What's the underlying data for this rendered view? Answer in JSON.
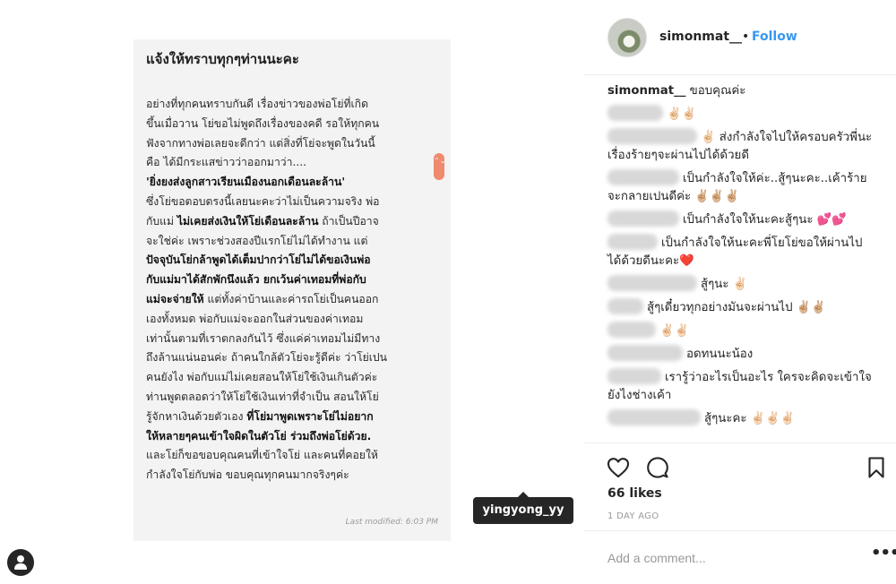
{
  "note": {
    "title": "แจ้งให้ทราบทุกๆท่านนะคะ",
    "lines": [
      "อย่างที่ทุกคนทราบกันดี เรื่องข่าวของพ่อโย่ที่เกิด",
      "ขึ้นเมื่อวาน โย่ขอไม่พูดถึงเรื่องของคดี รอให้ทุกคน",
      "ฟังจากทางพ่อเลยจะดีกว่า  แต่สิ่งที่โย่จะพูดในวันนี้",
      "คือ ได้มีกระแสข่าวว่าออกมาว่า....",
      "'ยิ่งยงส่งลูกสาวเรียนเมืองนอกเดือนละล้าน'",
      "ซึ่งโย่ขอตอบตรงนี้เลยนะคะว่าไม่เป็นความจริง พ่อ",
      "กับแม่ ",
      "ไม่เคยส่งเงินให้โย่เดือนละล้าน",
      " ถ้าเป็นปีอาจ",
      "จะใช่ค่ะ เพราะช่วงสองปีแรกโย่ไม่ได้ทำงาน แต่",
      "ปัจจุบันโย่กล้าพูดได้เต็มปากว่าโย่ไม่ได้ขอเงินพ่อ",
      "กับแม่มาได้สักพักนึงแล้ว ยกเว้นค่าเทอมที่พ่อกับ",
      "แม่จะจ่ายให้",
      " แต่ทั้งค่าบ้านและค่ารถโย่เป็นคนออก",
      "เองทั้งหมด พ่อกับแม่จะออกในส่วนของค่าเทอม",
      "เท่านั้นตามที่เราตกลงกันไว้ ซึ่งแค่ค่าเทอมไม่มีทาง",
      "ถึงล้านแน่นอนค่ะ ถ้าคนใกล้ตัวโย่จะรู้ดีค่ะ ว่าโย่เปน",
      "คนยังไง พ่อกับแม่ไม่เคยสอนให้โย่ใช้เงินเกินตัวค่ะ",
      "ท่านพูดตลอดว่าให้โย่ใช้เงินเท่าที่จำเป็น สอนให้โย่",
      "รู้จักหาเงินด้วยตัวเอง ",
      "ที่โย่มาพูดเพราะโย่ไม่อยาก",
      "ให้หลายๆคนเข้าใจผิดในตัวโย่ ร่วมถึงพ่อโย่ด้วย.",
      "และโย่ก็ขอขอบคุณคนที่เข้าใจโย่ และคนที่คอยให้",
      "กำลังใจโย่กับพ่อ ขอบคุณทุกคนมากจริงๆค่ะ"
    ],
    "scroll_glyph": "⌃⌄",
    "modified": "Last modified: 6:03 PM"
  },
  "user_tag": "yingyong_yy",
  "post": {
    "username": "simonmat__",
    "separator": "•",
    "follow_label": "Follow",
    "caption": "ขอบคุณค่ะ",
    "comments": [
      {
        "text": "✌🏻✌🏻"
      },
      {
        "text": "✌🏻 ส่งกำลังใจไปให้ครอบครัวพี่นะ เรื่องร้ายๆจะผ่านไปได้ด้วยดี"
      },
      {
        "text": "เป็นกำลังใจให้ค่ะ..สู้ๆนะคะ..เค้าร้ายจะกลายเปนดีค่ะ ✌🏼✌🏼✌🏼"
      },
      {
        "text": "เป็นกำลังใจให้นะคะสู้ๆนะ 💕💕"
      },
      {
        "text": "เป็นกำลังใจให้นะคะพี่โยโย่ขอให้ผ่านไปได้ด้วยดีนะคะ❤️"
      },
      {
        "text": "สู้ๆนะ ✌🏻"
      },
      {
        "text": "สู้ๆเดี๋ยวทุกอย่างมันจะผ่านไป ✌🏼✌🏼"
      },
      {
        "text": "✌🏻✌🏻"
      },
      {
        "text": "อดทนนะน้อง"
      },
      {
        "text": "เรารู้ว่าอะไรเป็นอะไร ใครจะคิดจะเข้าใจยังไงช่างเค้า"
      },
      {
        "text": "สู้ๆนะคะ ✌🏻✌🏻✌🏻"
      }
    ],
    "likes": "66 likes",
    "date": "1 DAY AGO",
    "comment_placeholder": "Add a comment...",
    "more_label": "•••"
  },
  "colors": {
    "accent": "#3897f0",
    "tag_bg": "#262626",
    "scroll_accent": "#f08a6e"
  }
}
